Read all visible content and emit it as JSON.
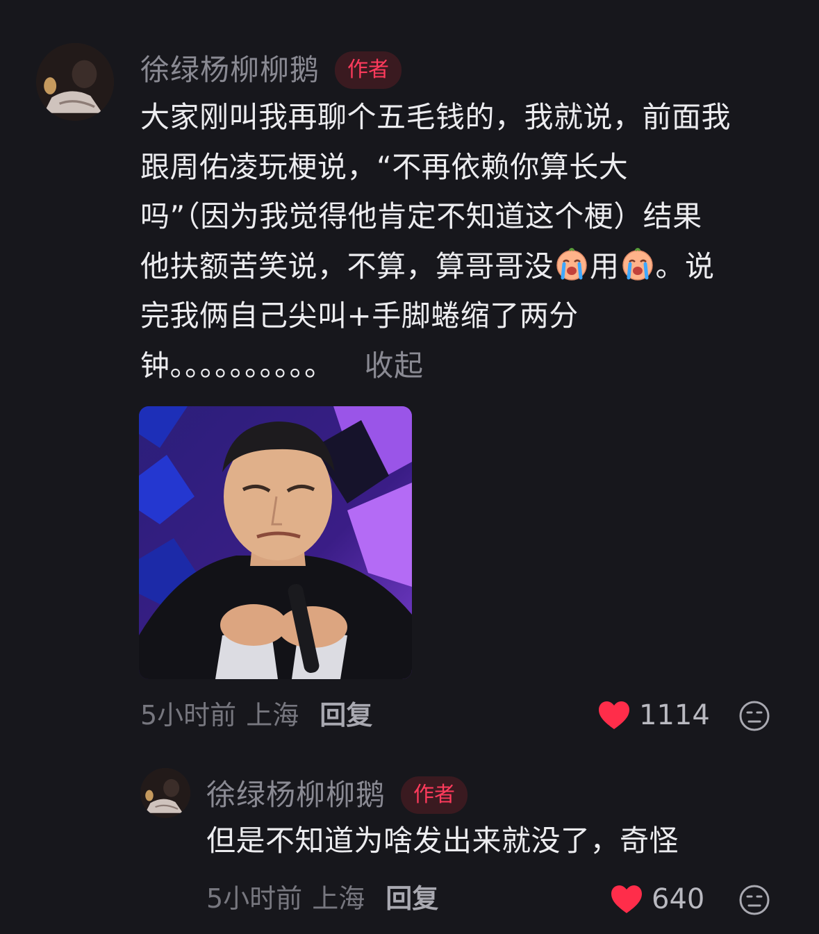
{
  "comment": {
    "author": "徐绿杨柳柳鹅",
    "badge": "作者",
    "text_line1": "大家刚叫我再聊个五毛钱的，我就说，前面我",
    "text_line2": "跟周佑凌玩梗说，“不再依赖你算长大",
    "text_line3": "吗”（因为我觉得他肯定不知道这个梗）结果",
    "text_line4a": "他扶额苦笑说，不算，算哥哥没",
    "text_line4b": "用",
    "text_line4c": "。说",
    "text_line5": "完我俩自己尖叫+手脚蜷缩了两分",
    "text_line6": "钟。。。。。。。。。。",
    "collapse_label": "收起",
    "emoji_icon": "loudly-crying-face-icon",
    "time": "5小时前",
    "location": "上海",
    "reply_label": "回复",
    "likes": "1114"
  },
  "reply": {
    "author": "徐绿杨柳柳鹅",
    "badge": "作者",
    "text": "但是不知道为啥发出来就没了，奇怪",
    "time": "5小时前",
    "location": "上海",
    "reply_label": "回复",
    "likes": "640"
  },
  "colors": {
    "background": "#17171c",
    "badge_text": "#ff3b5c",
    "heart": "#ff2d4a",
    "muted_text": "#8a8a93"
  }
}
